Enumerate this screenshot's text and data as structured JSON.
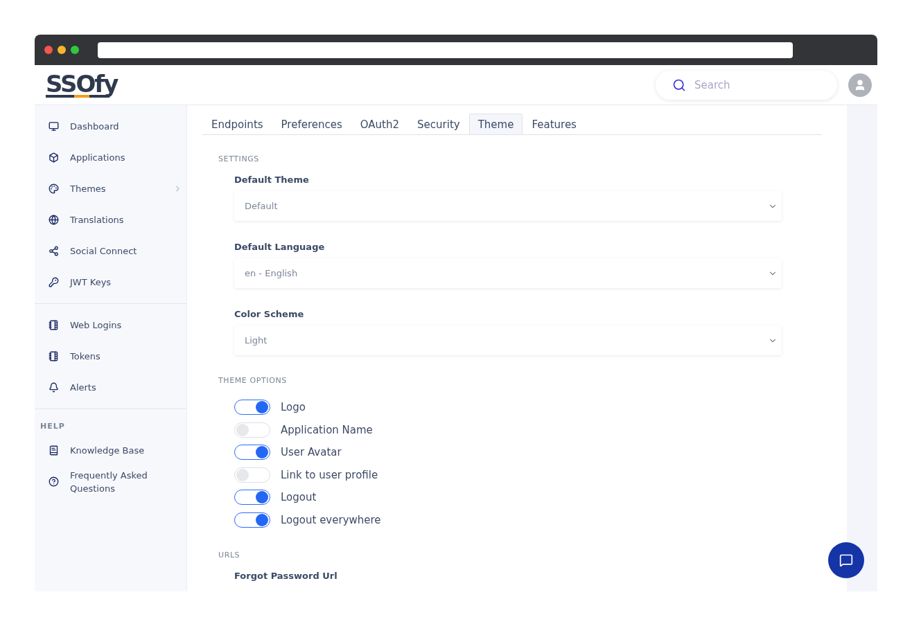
{
  "logo": {
    "text": "SSOfy"
  },
  "search": {
    "placeholder": "Search"
  },
  "sidebar": {
    "sections": [
      {
        "items": [
          {
            "label": "Dashboard",
            "expandable": false
          },
          {
            "label": "Applications",
            "expandable": false
          },
          {
            "label": "Themes",
            "expandable": true
          },
          {
            "label": "Translations",
            "expandable": false
          },
          {
            "label": "Social Connect",
            "expandable": false
          },
          {
            "label": "JWT Keys",
            "expandable": false
          }
        ]
      },
      {
        "items": [
          {
            "label": "Web Logins",
            "expandable": false
          },
          {
            "label": "Tokens",
            "expandable": false
          },
          {
            "label": "Alerts",
            "expandable": false
          }
        ]
      },
      {
        "title": "HELP",
        "items": [
          {
            "label": "Knowledge Base",
            "expandable": false
          },
          {
            "label": "Frequently Asked Questions",
            "expandable": false
          }
        ]
      }
    ]
  },
  "tabs": [
    {
      "label": "Endpoints",
      "selected": false
    },
    {
      "label": "Preferences",
      "selected": false
    },
    {
      "label": "OAuth2",
      "selected": false
    },
    {
      "label": "Security",
      "selected": false
    },
    {
      "label": "Theme",
      "selected": true
    },
    {
      "label": "Features",
      "selected": false
    }
  ],
  "sections": [
    {
      "title": "SETTINGS",
      "kind": "selects",
      "fields": [
        {
          "label": "Default Theme",
          "value": "Default"
        },
        {
          "label": "Default Language",
          "value": "en - English"
        },
        {
          "label": "Color Scheme",
          "value": "Light"
        }
      ]
    },
    {
      "title": "THEME OPTIONS",
      "kind": "toggles",
      "options": [
        {
          "label": "Logo",
          "on": true
        },
        {
          "label": "Application Name",
          "on": false
        },
        {
          "label": "User Avatar",
          "on": true
        },
        {
          "label": "Link to user profile",
          "on": false
        },
        {
          "label": "Logout",
          "on": true
        },
        {
          "label": "Logout everywhere",
          "on": true
        }
      ]
    },
    {
      "title": "URLS",
      "kind": "labels",
      "fields": [
        {
          "label": "Forgot Password Url"
        }
      ]
    }
  ]
}
